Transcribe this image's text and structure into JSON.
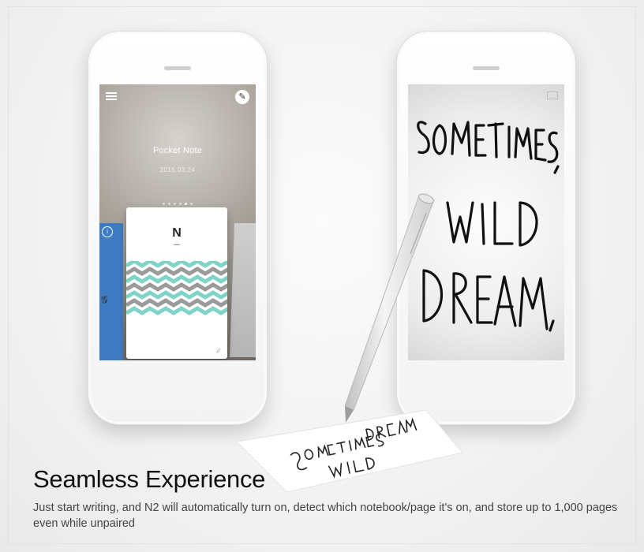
{
  "headline": "Seamless Experience",
  "body": "Just start writing, and N2 will automatically turn on, detect which notebook/page it's on, and store up to 1,000 pages even while unpaired",
  "left_phone": {
    "note_title": "Pocket Note",
    "note_date": "2015.03.24",
    "notebook_logo": "N",
    "icons": [
      "menu-icon",
      "pen-icon",
      "info-icon"
    ]
  },
  "right_phone": {
    "handwriting_lines": [
      "SOMETIMES,",
      "WILD",
      "DREAM,"
    ]
  },
  "colors": {
    "accent_blue": "#3f7bc2",
    "chevron_teal": "#7fd3c7",
    "chevron_gray": "#9a9a9a",
    "pen_silver": "#d9d9d9"
  }
}
